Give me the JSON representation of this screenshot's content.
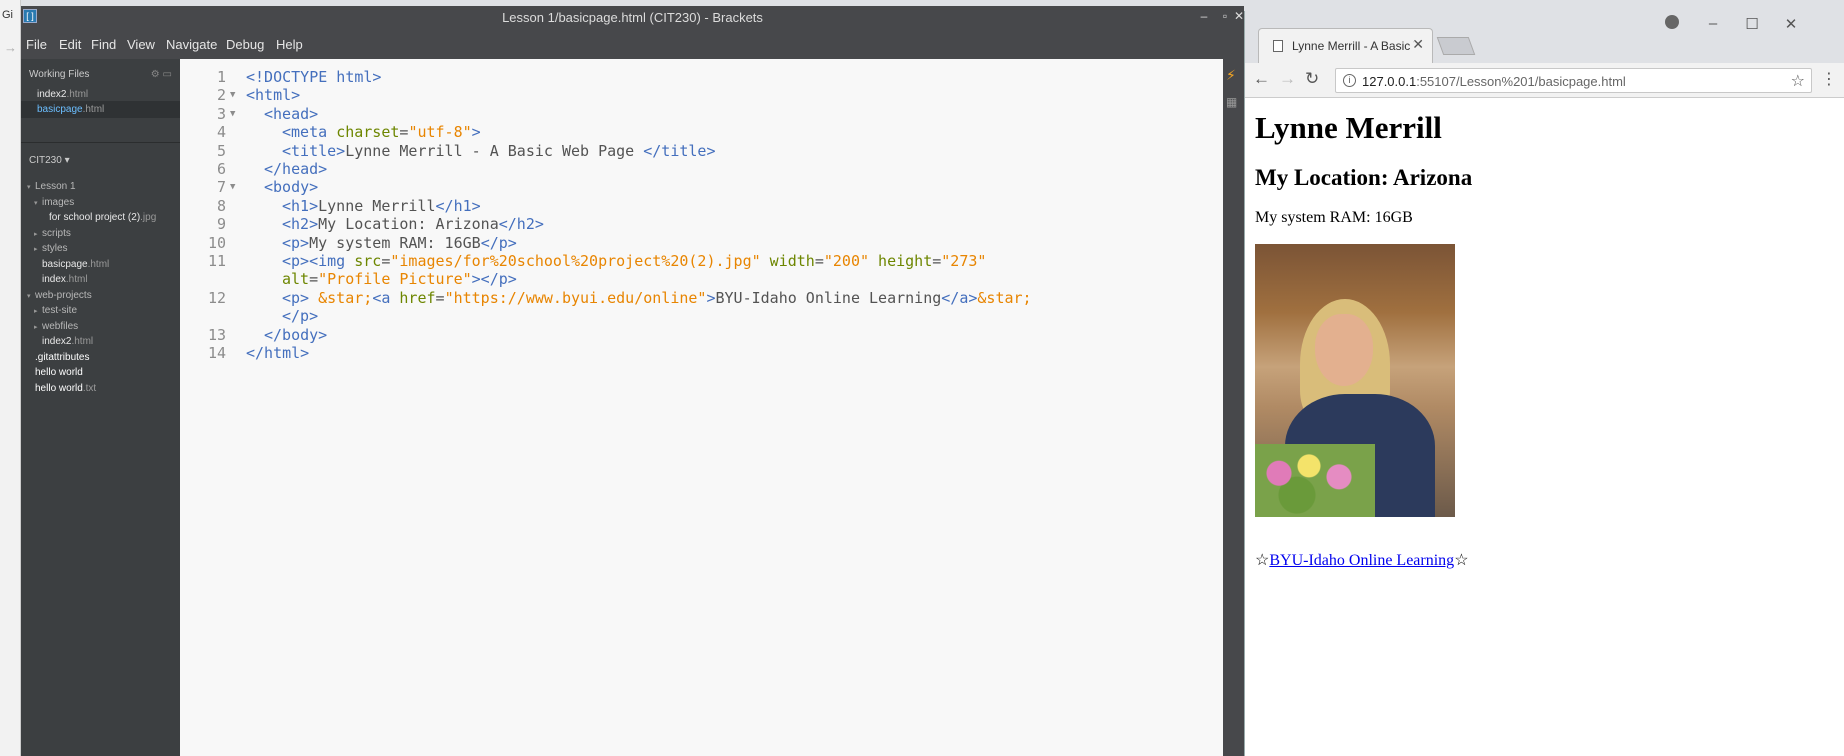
{
  "background_browser": {
    "tab_label": "Gi"
  },
  "brackets": {
    "window_title": "Lesson 1/basicpage.html (CIT230) - Brackets",
    "menu": [
      "File",
      "Edit",
      "Find",
      "View",
      "Navigate",
      "Debug",
      "Help"
    ],
    "sidebar": {
      "working_files_title": "Working Files",
      "working_files": [
        {
          "name": "index2",
          "ext": ".html",
          "active": false
        },
        {
          "name": "basicpage",
          "ext": ".html",
          "active": true
        }
      ],
      "project_title": "CIT230 ▾",
      "tree": [
        {
          "label": "Lesson 1",
          "ext": "",
          "indent": 0,
          "arrow": "▾"
        },
        {
          "label": "images",
          "ext": "",
          "indent": 1,
          "arrow": "▾"
        },
        {
          "label": "for school project (2)",
          "ext": ".jpg",
          "indent": 2,
          "arrow": ""
        },
        {
          "label": "scripts",
          "ext": "",
          "indent": 1,
          "arrow": "▸"
        },
        {
          "label": "styles",
          "ext": "",
          "indent": 1,
          "arrow": "▸"
        },
        {
          "label": "basicpage",
          "ext": ".html",
          "indent": 1,
          "arrow": ""
        },
        {
          "label": "index",
          "ext": ".html",
          "indent": 1,
          "arrow": ""
        },
        {
          "label": "web-projects",
          "ext": "",
          "indent": 0,
          "arrow": "▾"
        },
        {
          "label": "test-site",
          "ext": "",
          "indent": 1,
          "arrow": "▸"
        },
        {
          "label": "webfiles",
          "ext": "",
          "indent": 1,
          "arrow": "▸"
        },
        {
          "label": "index2",
          "ext": ".html",
          "indent": 1,
          "arrow": ""
        },
        {
          "label": ".gitattributes",
          "ext": "",
          "indent": 0,
          "arrow": ""
        },
        {
          "label": "hello world",
          "ext": "",
          "indent": 0,
          "arrow": ""
        },
        {
          "label": "hello world",
          "ext": ".txt",
          "indent": 0,
          "arrow": ""
        }
      ]
    },
    "code_lines": [
      {
        "n": "1",
        "fold": "",
        "indent": 0,
        "parts": [
          [
            "tag",
            "<!DOCTYPE html>"
          ]
        ]
      },
      {
        "n": "2",
        "fold": "▼",
        "indent": 0,
        "parts": [
          [
            "tag",
            "<html>"
          ]
        ]
      },
      {
        "n": "3",
        "fold": "▼",
        "indent": 1,
        "parts": [
          [
            "tag",
            "<head>"
          ]
        ]
      },
      {
        "n": "4",
        "fold": "",
        "indent": 2,
        "parts": [
          [
            "tag",
            "<meta "
          ],
          [
            "attr",
            "charset"
          ],
          [
            "txt",
            "="
          ],
          [
            "val",
            "\"utf-8\""
          ],
          [
            "tag",
            ">"
          ]
        ]
      },
      {
        "n": "5",
        "fold": "",
        "indent": 2,
        "parts": [
          [
            "tag",
            "<title>"
          ],
          [
            "txt",
            "Lynne Merrill - A Basic Web Page "
          ],
          [
            "tag",
            "</title>"
          ]
        ]
      },
      {
        "n": "6",
        "fold": "",
        "indent": 1,
        "parts": [
          [
            "tag",
            "</head>"
          ]
        ]
      },
      {
        "n": "7",
        "fold": "▼",
        "indent": 1,
        "parts": [
          [
            "tag",
            "<body>"
          ]
        ]
      },
      {
        "n": "8",
        "fold": "",
        "indent": 2,
        "parts": [
          [
            "tag",
            "<h1>"
          ],
          [
            "txt",
            "Lynne Merrill"
          ],
          [
            "tag",
            "</h1>"
          ]
        ]
      },
      {
        "n": "9",
        "fold": "",
        "indent": 2,
        "parts": [
          [
            "tag",
            "<h2>"
          ],
          [
            "txt",
            "My Location: Arizona"
          ],
          [
            "tag",
            "</h2>"
          ]
        ]
      },
      {
        "n": "10",
        "fold": "",
        "indent": 2,
        "parts": [
          [
            "tag",
            "<p>"
          ],
          [
            "txt",
            "My system RAM: 16GB"
          ],
          [
            "tag",
            "</p>"
          ]
        ]
      },
      {
        "n": "11",
        "fold": "",
        "indent": 2,
        "parts": [
          [
            "tag",
            "<p><img "
          ],
          [
            "attr",
            "src"
          ],
          [
            "txt",
            "="
          ],
          [
            "val",
            "\"images/for%20school%20project%20(2).jpg\""
          ],
          [
            "txt",
            " "
          ],
          [
            "attr",
            "width"
          ],
          [
            "txt",
            "="
          ],
          [
            "val",
            "\"200\""
          ],
          [
            "txt",
            " "
          ],
          [
            "attr",
            "height"
          ],
          [
            "txt",
            "="
          ],
          [
            "val",
            "\"273\""
          ]
        ]
      },
      {
        "n": "",
        "fold": "",
        "indent": 2,
        "parts": [
          [
            "attr",
            "alt"
          ],
          [
            "txt",
            "="
          ],
          [
            "val",
            "\"Profile Picture\""
          ],
          [
            "tag",
            "></p>"
          ]
        ]
      },
      {
        "n": "12",
        "fold": "",
        "indent": 2,
        "parts": [
          [
            "tag",
            "<p> "
          ],
          [
            "ent",
            "&star;"
          ],
          [
            "tag",
            "<a "
          ],
          [
            "attr",
            "href"
          ],
          [
            "txt",
            "="
          ],
          [
            "val",
            "\"https://www.byui.edu/online\""
          ],
          [
            "tag",
            ">"
          ],
          [
            "txt",
            "BYU-Idaho Online Learning"
          ],
          [
            "tag",
            "</a>"
          ],
          [
            "ent",
            "&star;"
          ]
        ]
      },
      {
        "n": "",
        "fold": "",
        "indent": 2,
        "parts": [
          [
            "tag",
            "</p>"
          ]
        ]
      },
      {
        "n": "13",
        "fold": "",
        "indent": 1,
        "parts": [
          [
            "tag",
            "</body>"
          ]
        ]
      },
      {
        "n": "14",
        "fold": "",
        "indent": 0,
        "parts": [
          [
            "tag",
            "</html>"
          ]
        ]
      }
    ]
  },
  "chrome": {
    "tab_title": "Lynne Merrill - A Basic W",
    "url_host": "127.0.0.1",
    "url_path": ":55107/Lesson%201/basicpage.html",
    "page": {
      "h1": "Lynne Merrill",
      "h2": "My Location: Arizona",
      "p": "My system RAM: 16GB",
      "img_alt": "Profile Picture",
      "star": "☆",
      "link_text": "BYU-Idaho Online Learning"
    }
  },
  "colors": {
    "brackets_chrome": "#47484b",
    "sidebar_bg": "#3c3f41",
    "active_file": "#6bbeff",
    "code_tag": "#446fbd",
    "code_attr": "#6d8600",
    "code_value": "#e88501",
    "link": "#0000ee"
  }
}
